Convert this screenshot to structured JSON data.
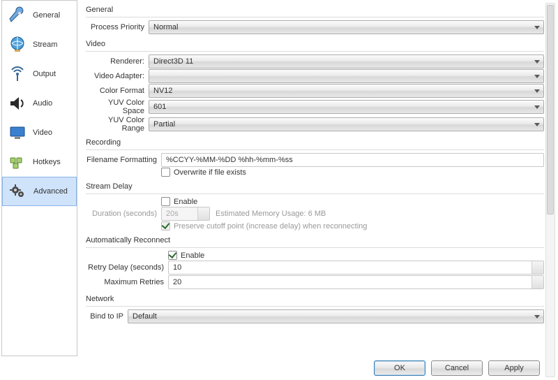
{
  "sidebar": {
    "items": [
      {
        "label": "General"
      },
      {
        "label": "Stream"
      },
      {
        "label": "Output"
      },
      {
        "label": "Audio"
      },
      {
        "label": "Video"
      },
      {
        "label": "Hotkeys"
      },
      {
        "label": "Advanced"
      }
    ]
  },
  "sections": {
    "general": {
      "title": "General",
      "process_priority_label": "Process Priority",
      "process_priority_value": "Normal"
    },
    "video": {
      "title": "Video",
      "renderer_label": "Renderer:",
      "renderer_value": "Direct3D 11",
      "adapter_label": "Video Adapter:",
      "adapter_value": "",
      "color_format_label": "Color Format",
      "color_format_value": "NV12",
      "yuv_space_label": "YUV Color Space",
      "yuv_space_value": "601",
      "yuv_range_label": "YUV Color Range",
      "yuv_range_value": "Partial"
    },
    "recording": {
      "title": "Recording",
      "filename_label": "Filename Formatting",
      "filename_value": "%CCYY-%MM-%DD %hh-%mm-%ss",
      "overwrite_label": "Overwrite if file exists",
      "overwrite_checked": false
    },
    "stream_delay": {
      "title": "Stream Delay",
      "enable_label": "Enable",
      "enable_checked": false,
      "duration_label": "Duration (seconds)",
      "duration_value": "20s",
      "memory_label": "Estimated Memory Usage: 6 MB",
      "preserve_label": "Preserve cutoff point (increase delay) when reconnecting",
      "preserve_checked": true
    },
    "auto_reconnect": {
      "title": "Automatically Reconnect",
      "enable_label": "Enable",
      "enable_checked": true,
      "retry_delay_label": "Retry Delay (seconds)",
      "retry_delay_value": "10",
      "max_retries_label": "Maximum Retries",
      "max_retries_value": "20"
    },
    "network": {
      "title": "Network",
      "bind_label": "Bind to IP",
      "bind_value": "Default"
    }
  },
  "footer": {
    "ok": "OK",
    "cancel": "Cancel",
    "apply": "Apply"
  }
}
